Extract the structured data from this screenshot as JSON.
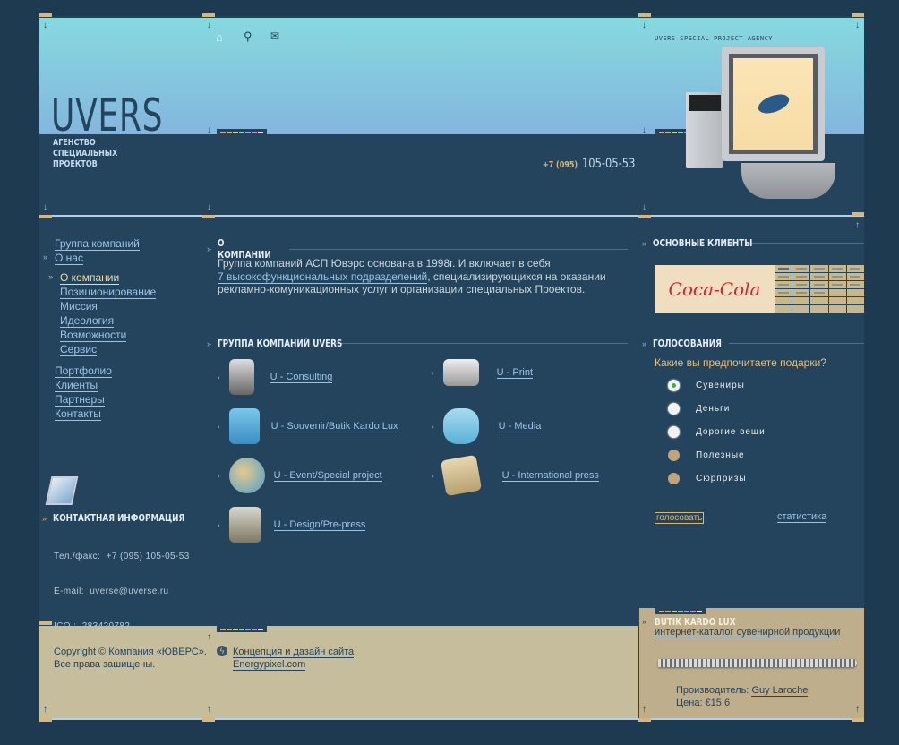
{
  "header": {
    "logo": "UVERS",
    "tagline": [
      "АГЕНСТВО",
      "СПЕЦИАЛЬНЫХ",
      "ПРОЕКТОВ"
    ],
    "agency": "UVERS SPECIAL PROJECT AGENCY",
    "phone_code": "+7 (095)",
    "phone": "105-05-53",
    "icons": [
      "home-icon",
      "search-icon",
      "mail-icon"
    ],
    "palette": [
      "#d8a88a",
      "#d7b67a",
      "#c9d98a",
      "#8fd8a8",
      "#8fb0e0",
      "#c490d8",
      "#e8e8e8"
    ]
  },
  "nav": {
    "items": [
      {
        "label": "Группа компаний"
      },
      {
        "label": "О нас"
      }
    ],
    "sub": [
      {
        "label": "О компании",
        "active": true
      },
      {
        "label": "Позиционирование"
      },
      {
        "label": "Миссия"
      },
      {
        "label": "Идеология"
      },
      {
        "label": "Возможности"
      },
      {
        "label": "Сервис"
      }
    ],
    "items2": [
      {
        "label": "Портфолио"
      },
      {
        "label": "Клиенты"
      },
      {
        "label": "Партнеры"
      },
      {
        "label": "Контакты"
      }
    ]
  },
  "contact": {
    "title": "КОНТАКТНАЯ ИНФОРМАЦИЯ",
    "phone": "Тел./факс:  +7 (095) 105-05-53",
    "email": "E-mail:  uverse@uverse.ru",
    "icq": "ICQ :  283420782"
  },
  "about": {
    "title": "О КОМПАНИИ",
    "text1": "Группа компаний АСП Ювэрс основана в 1998г. И включает в себя",
    "link": "7 высокофункциональных подразделений",
    "text2": ", специализирующихся на оказании рекламно-комуникационных услуг и организации специальных Проектов."
  },
  "group": {
    "title": "ГРУППА КОМПАНИЙ UVERS",
    "companies": [
      {
        "label": "U - Consulting",
        "icon": "phone-icon"
      },
      {
        "label": "U - Print",
        "icon": "printer-icon"
      },
      {
        "label": "U - Souvenir/Butik Kardo Lux",
        "icon": "bag-icon"
      },
      {
        "label": "U - Media",
        "icon": "computer-icon"
      },
      {
        "label": "U - Event/Special project",
        "icon": "balloons-icon"
      },
      {
        "label": "U - International press",
        "icon": "newspaper-icon"
      },
      {
        "label": "U - Design/Pre-press",
        "icon": "paint-can-icon"
      }
    ]
  },
  "clients": {
    "title": "ОСНОВНЫЕ КЛИЕНТЫ",
    "logo": "Coca-Cola"
  },
  "poll": {
    "title": "ГОЛОСОВАНИЯ",
    "question": "Какие вы предпочитаете подарки?",
    "options": [
      "Сувениры",
      "Деньги",
      "Дорогие вещи",
      "Полезные",
      "Сюрпризы"
    ],
    "selected": 0,
    "vote": "голосовать",
    "stats": "статистика"
  },
  "footer": {
    "copyright1": "Copyright © Компания «ЮВЕРС».",
    "copyright2": "Все права зашищены.",
    "design": "Концепция и дазайн сайта",
    "designer": "Energypixel.com"
  },
  "promo": {
    "title": "BUTIK KARDO LUX",
    "subtitle": "интернет-каталог сувенирной продукции",
    "maker_label": "Производитель:",
    "maker": "Guy Laroche",
    "price": "Цена: €15.6"
  }
}
